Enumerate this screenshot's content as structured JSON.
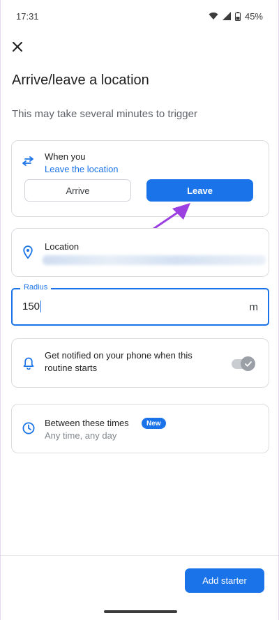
{
  "status_bar": {
    "time": "17:31",
    "battery": "45%"
  },
  "header": {
    "title": "Arrive/leave a location",
    "subtitle": "This may take several minutes to trigger"
  },
  "when_card": {
    "label": "When you",
    "value": "Leave the location",
    "options": [
      {
        "label": "Arrive",
        "selected": false
      },
      {
        "label": "Leave",
        "selected": true
      }
    ]
  },
  "location_card": {
    "label": "Location"
  },
  "radius_field": {
    "label": "Radius",
    "value": "150",
    "unit": "m"
  },
  "notify_card": {
    "text": "Get notified on your phone when this routine starts",
    "toggle_on": true
  },
  "times_card": {
    "label": "Between these times",
    "badge": "New",
    "value": "Any time, any day"
  },
  "footer": {
    "add_starter_label": "Add starter"
  },
  "colors": {
    "accent": "#1a73e8",
    "annotation_arrow": "#9b3fe0"
  },
  "icons": {
    "close": "close-icon",
    "swap": "swap-arrows-icon",
    "location": "location-pin-icon",
    "notify": "bell-icon",
    "times": "clock-icon"
  }
}
